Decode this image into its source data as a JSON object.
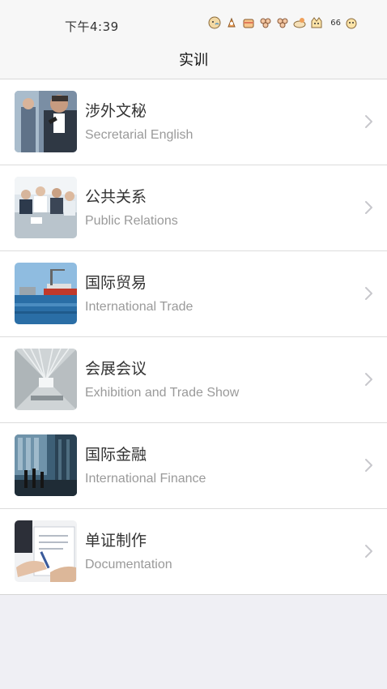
{
  "status_bar": {
    "time": "下午4:39",
    "battery": "66",
    "icons": [
      "sticker-icon",
      "sticker-icon",
      "sticker-icon",
      "sticker-icon",
      "sticker-icon",
      "sticker-icon",
      "sticker-icon"
    ]
  },
  "nav": {
    "title": "实训"
  },
  "items": [
    {
      "title": "涉外文秘",
      "subtitle": "Secretarial English",
      "image": "businessman-phone-photo"
    },
    {
      "title": "公共关系",
      "subtitle": "Public Relations",
      "image": "meeting-photo"
    },
    {
      "title": "国际贸易",
      "subtitle": "International Trade",
      "image": "cargo-ship-photo"
    },
    {
      "title": "会展会议",
      "subtitle": "Exhibition and Trade Show",
      "image": "exhibition-hall-photo"
    },
    {
      "title": "国际金融",
      "subtitle": "International Finance",
      "image": "financial-district-photo"
    },
    {
      "title": "单证制作",
      "subtitle": "Documentation",
      "image": "documents-signing-photo"
    }
  ],
  "colors": {
    "background": "#efeff4",
    "bar": "#f7f7f7",
    "title_text": "#333333",
    "subtitle_text": "#9a9a9a",
    "chevron": "#c7c7cc"
  }
}
